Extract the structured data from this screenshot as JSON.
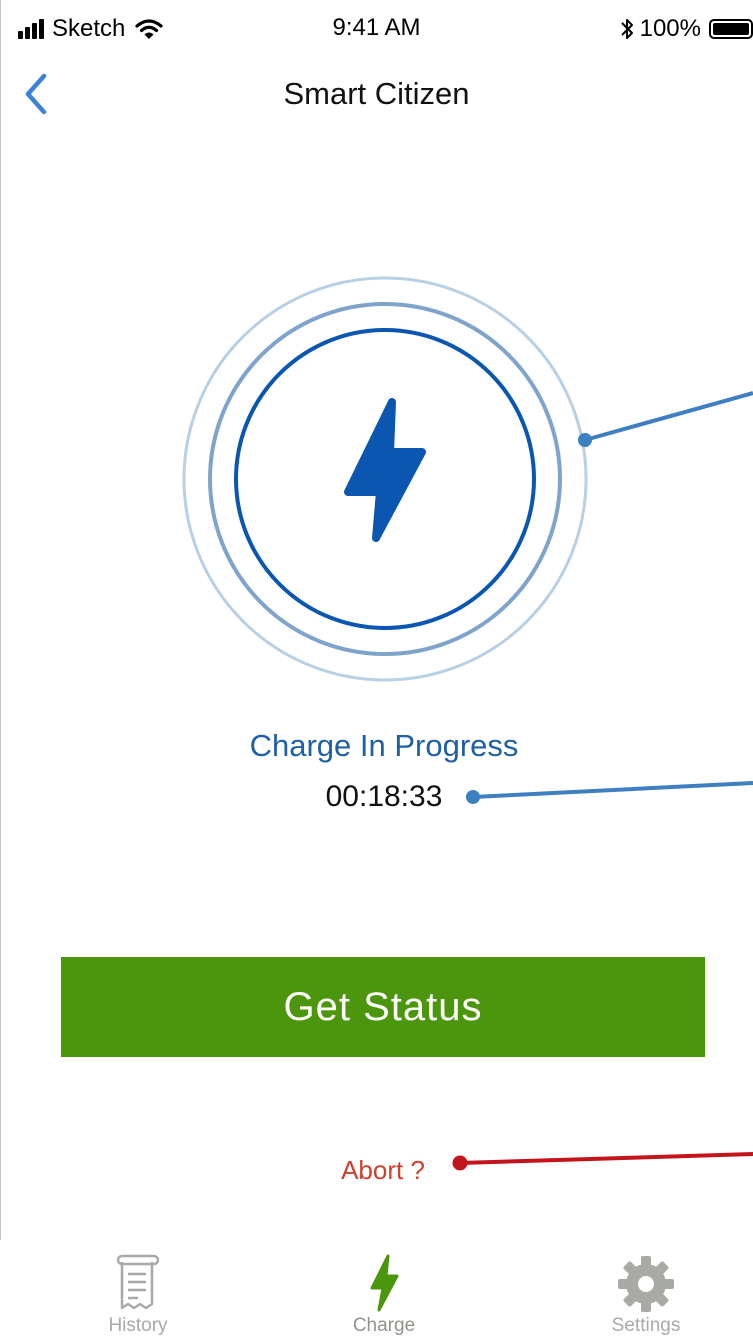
{
  "status_bar": {
    "carrier": "Sketch",
    "time": "9:41 AM",
    "battery_percent": "100%",
    "battery_level": 1.0
  },
  "nav": {
    "title": "Smart Citizen",
    "back_icon": "chevron-left-icon"
  },
  "charge": {
    "icon": "lightning-bolt-icon",
    "status_text": "Charge In Progress",
    "elapsed_time": "00:18:33"
  },
  "actions": {
    "get_status_label": "Get Status",
    "abort_label": "Abort ?"
  },
  "tabs": [
    {
      "label": "History",
      "icon": "receipt-icon",
      "active": false
    },
    {
      "label": "Charge",
      "icon": "lightning-bolt-icon",
      "active": true
    },
    {
      "label": "Settings",
      "icon": "gear-icon",
      "active": false
    }
  ],
  "colors": {
    "accent_blue": "#1f5fa6",
    "ring_dark": "#0a56b0",
    "ring_mid": "#7ea4cc",
    "ring_light": "#b8d0e6",
    "button_green": "#4b960c",
    "abort_red": "#d0402a",
    "annotation_blue": "#3d7fc0",
    "annotation_red": "#c4141b",
    "tab_active_icon": "#4b960c",
    "tab_inactive": "#a8aaa6"
  }
}
